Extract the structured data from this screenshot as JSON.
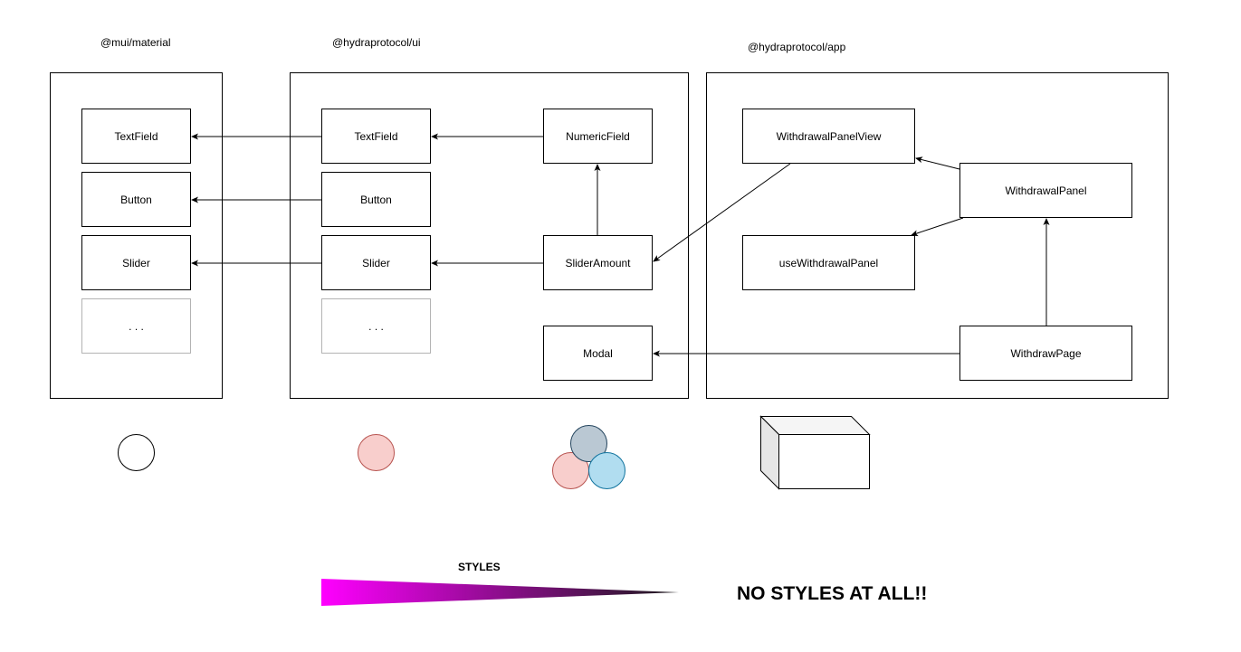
{
  "packages": {
    "mui": {
      "label": "@mui/material",
      "components": [
        "TextField",
        "Button",
        "Slider",
        ". . ."
      ]
    },
    "ui": {
      "label": "@hydraprotocol/ui",
      "components": [
        "TextField",
        "Button",
        "Slider",
        ". . .",
        "NumericField",
        "SliderAmount",
        "Modal"
      ]
    },
    "app": {
      "label": "@hydraprotocol/app",
      "components": [
        "WithdrawalPanelView",
        "WithdrawalPanel",
        "useWithdrawalPanel",
        "WithdrawPage"
      ]
    }
  },
  "legend": {
    "styles_label": "STYLES",
    "no_styles_label": "NO STYLES AT ALL!!",
    "colors": {
      "circle_white": "#ffffff",
      "circle_pink": "#f8cecc",
      "circle_pink_stroke": "#b85450",
      "circle_gray": "#bac8d3",
      "circle_gray_stroke": "#23445d",
      "circle_blue": "#b1ddf0",
      "circle_blue_stroke": "#10739e",
      "gradient_start": "#ff00ff",
      "gradient_end": "#1a1a1a"
    }
  }
}
